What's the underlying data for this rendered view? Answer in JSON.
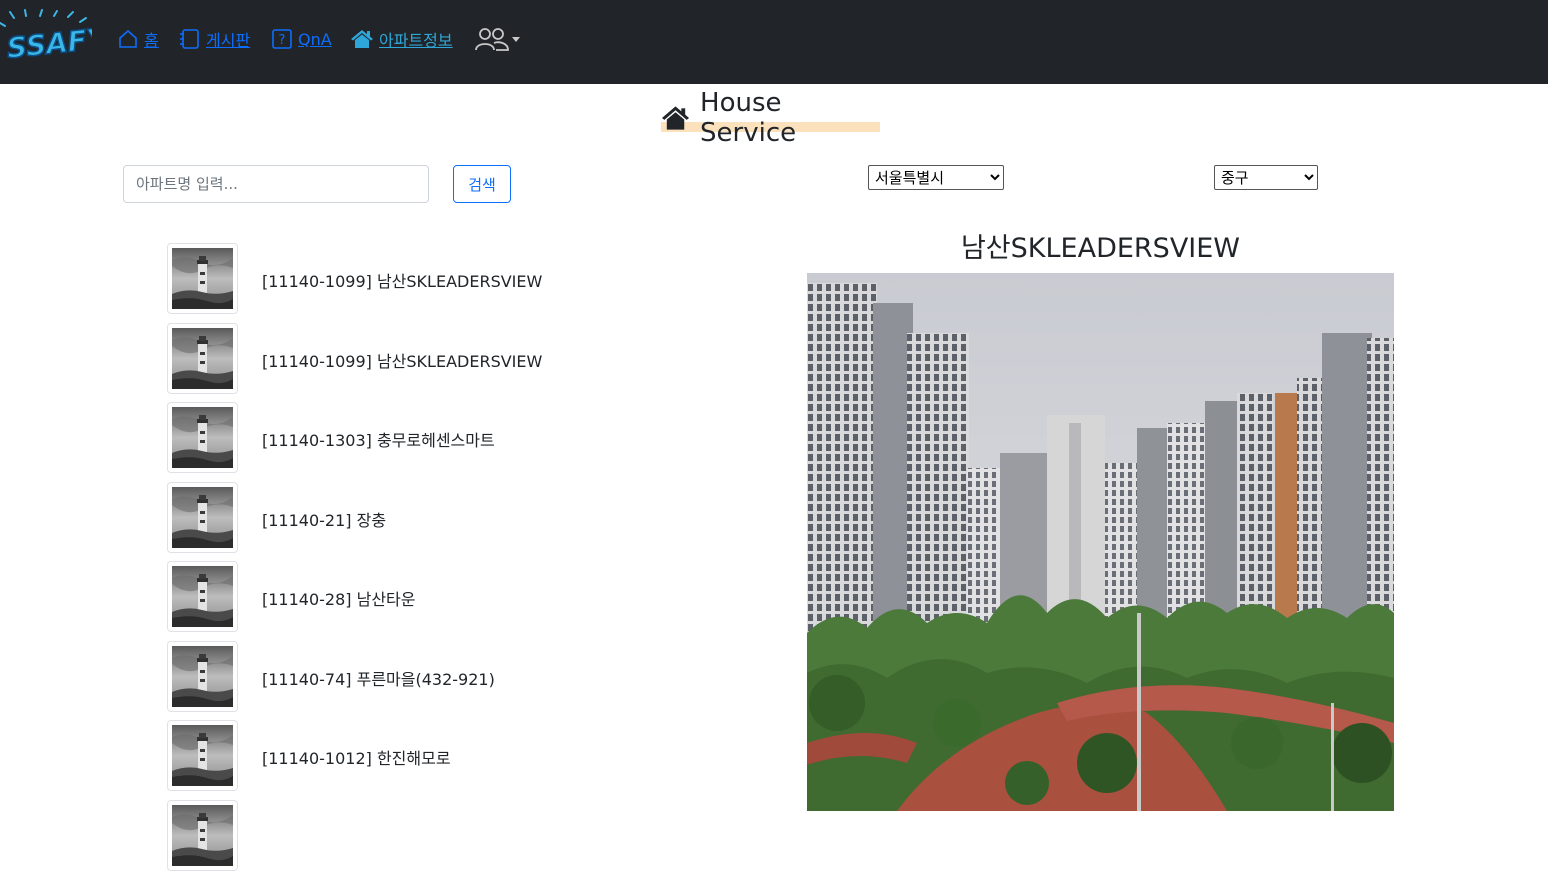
{
  "nav": {
    "logo_text": "SSAFY",
    "items": [
      {
        "label": "홈",
        "icon": "home-outline-icon"
      },
      {
        "label": "게시판",
        "icon": "notebook-icon"
      },
      {
        "label": "QnA",
        "icon": "question-square-icon"
      },
      {
        "label": "아파트정보",
        "icon": "house-fill-icon"
      }
    ],
    "user_menu_icon": "people-icon"
  },
  "page": {
    "title": "House Service",
    "title_icon": "house-fill-icon",
    "highlight_color": "#fbe2bd"
  },
  "search": {
    "placeholder": "아파트명 입력...",
    "value": "",
    "button_label": "검색"
  },
  "filters": {
    "city_selected": "서울특별시",
    "district_selected": "중구"
  },
  "apartments": [
    {
      "label": "[11140-1099] 남산SKLEADERSVIEW"
    },
    {
      "label": "[11140-1099] 남산SKLEADERSVIEW"
    },
    {
      "label": "[11140-1303] 충무로헤센스마트"
    },
    {
      "label": "[11140-21] 장충"
    },
    {
      "label": "[11140-28] 남산타운"
    },
    {
      "label": "[11140-74] 푸른마을(432-921)"
    },
    {
      "label": "[11140-1012] 한진해모로"
    },
    {
      "label": ""
    }
  ],
  "detail": {
    "title": "남산SKLEADERSVIEW"
  },
  "colors": {
    "navbar_bg": "#212529",
    "link_blue": "#0d6efd",
    "link_teal": "#2fa6d9"
  }
}
